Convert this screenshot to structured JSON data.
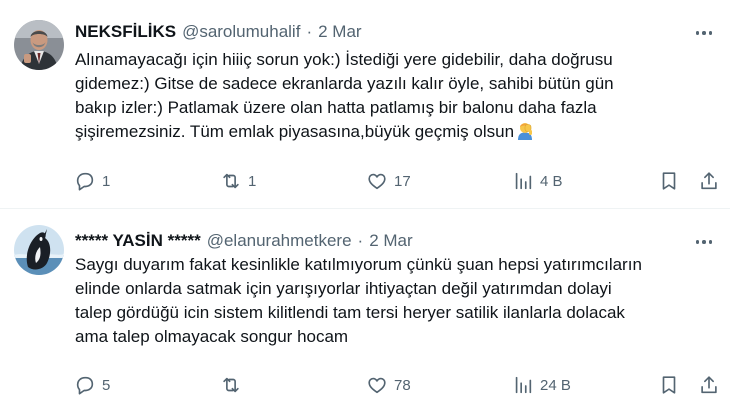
{
  "tweets": [
    {
      "author_name": "NEKSFİLİKS",
      "handle": "@sarolumuhalif",
      "separator": "·",
      "date": "2 Mar",
      "text_lines": [
        "Alınamayacağı için hiiiç sorun yok:) İstediği yere gidebilir, daha doğrusu",
        "gidemez:) Gitse de sadece ekranlarda yazılı kalır öyle, sahibi bütün gün",
        "bakıp izler:) Patlamak üzere olan hatta patlamış bir balonu daha fazla",
        "şişiremezsiniz. Tüm emlak piyasasına,büyük geçmiş olsun"
      ],
      "emoji": "person-facepalming-emoji",
      "counts": {
        "replies": "1",
        "reposts": "1",
        "likes": "17",
        "views": "4 B"
      }
    },
    {
      "author_name": "***** YASİN *****",
      "handle": "@elanurahmetkere",
      "separator": "·",
      "date": "2 Mar",
      "text_lines": [
        "Saygı duyarım fakat kesinlikle katılmıyorum çünkü şuan hepsi yatırımcıların",
        "elinde onlarda satmak için yarışıyorlar  ihtiyaçtan değil yatırımdan dolayi",
        "talep gördüğü icin sistem kilitlendi tam tersi heryer satilik ilanlarla dolacak",
        "ama talep olmayacak songur hocam"
      ],
      "counts": {
        "replies": "5",
        "reposts": "",
        "likes": "78",
        "views": "24 B"
      }
    }
  ],
  "colors": {
    "text_primary": "#0f1419",
    "text_secondary": "#536471",
    "divider": "#eff3f4",
    "background": "#ffffff"
  },
  "icons": [
    "more-icon",
    "reply-icon",
    "repost-icon",
    "like-icon",
    "views-icon",
    "bookmark-icon",
    "share-icon"
  ]
}
